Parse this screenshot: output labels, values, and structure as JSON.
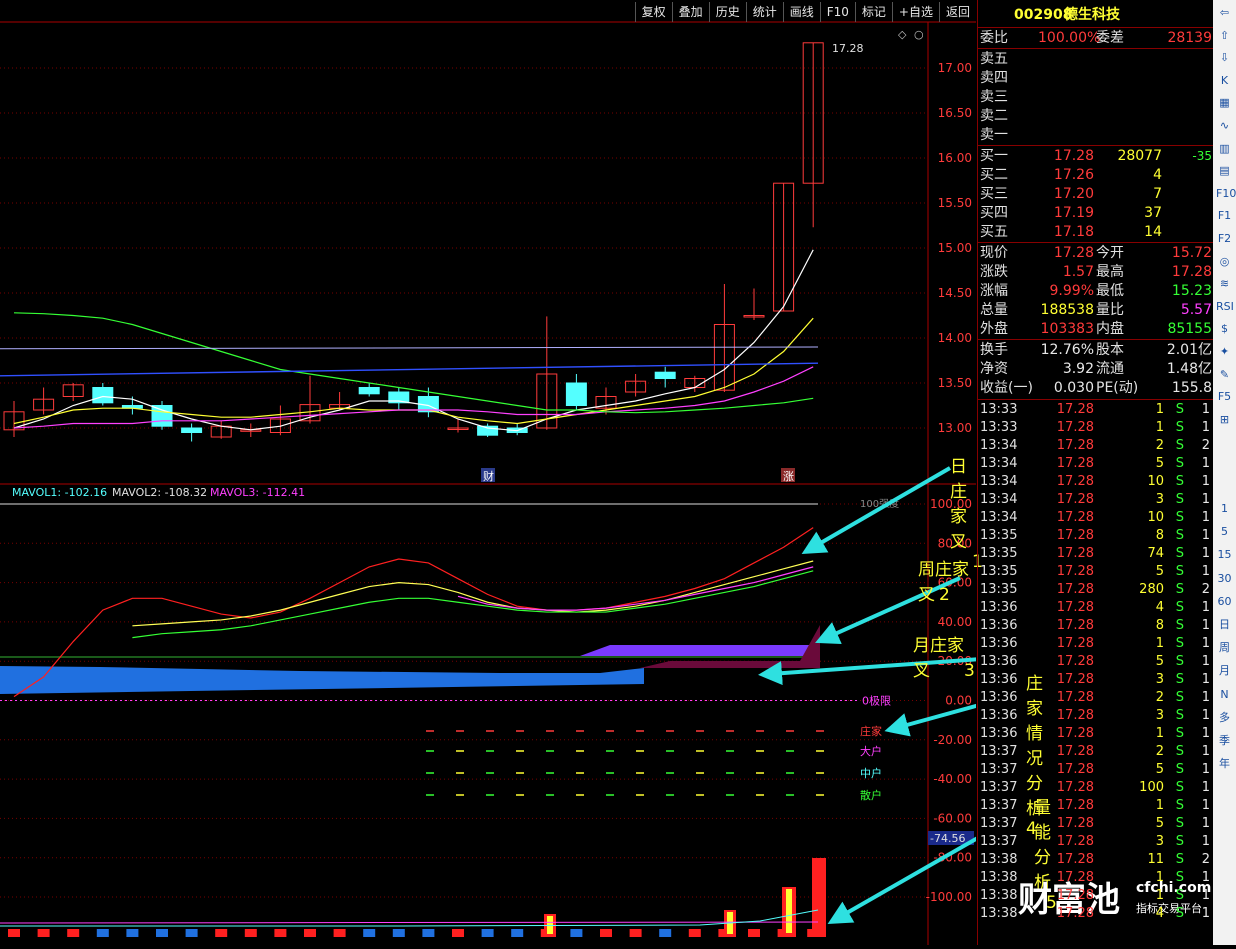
{
  "toolbar": [
    "复权",
    "叠加",
    "历史",
    "统计",
    "画线",
    "F10",
    "标记",
    "+自选",
    "返回"
  ],
  "stock": {
    "code": "002908",
    "name": "德生科技"
  },
  "price_axis": [
    "17.00",
    "16.50",
    "16.00",
    "15.50",
    "15.00",
    "14.50",
    "14.00",
    "13.50",
    "13.00"
  ],
  "last_price_label": "17.28",
  "markers": {
    "cai": "财",
    "zhang": "涨"
  },
  "mavol": {
    "mavol1": "MAVOL1: -102.16",
    "mavol2": "MAVOL2: -108.32",
    "mavol3": "MAVOL3: -112.41"
  },
  "ind_axis": [
    "100.00",
    "80.00",
    "60.00",
    "40.00",
    "20.00",
    "0.00",
    "-20.00",
    "-40.00",
    "-60.00",
    "-80.00",
    "-100.00"
  ],
  "ind_cur_value": "-74.56",
  "ind_100_label": "100强度",
  "ind_legend": {
    "zero": "0极限",
    "zhuangjia": "庄家",
    "dahu": "大户",
    "zhonghu": "中户",
    "sanhu": "散户"
  },
  "annotations": [
    {
      "text": "日庄家叉",
      "num": "1"
    },
    {
      "text": "周庄家叉",
      "num": "2"
    },
    {
      "text": "月庄家叉",
      "num": "3"
    },
    {
      "text": "庄家情况分析",
      "num": "4"
    },
    {
      "text": "量能分析",
      "num": "5"
    }
  ],
  "quote": {
    "weibi_label": "委比",
    "weibi": "100.00%",
    "weicha_label": "委差",
    "weicha": "28139",
    "sell": [
      {
        "label": "卖五"
      },
      {
        "label": "卖四"
      },
      {
        "label": "卖三"
      },
      {
        "label": "卖二"
      },
      {
        "label": "卖一"
      }
    ],
    "buy": [
      {
        "label": "买一",
        "price": "17.28",
        "vol": "28077",
        "chg": "-35"
      },
      {
        "label": "买二",
        "price": "17.26",
        "vol": "4",
        "chg": ""
      },
      {
        "label": "买三",
        "price": "17.20",
        "vol": "7",
        "chg": ""
      },
      {
        "label": "买四",
        "price": "17.19",
        "vol": "37",
        "chg": ""
      },
      {
        "label": "买五",
        "price": "17.18",
        "vol": "14",
        "chg": ""
      }
    ],
    "stats": [
      {
        "l1": "现价",
        "v1": "17.28",
        "c1": "red",
        "l2": "今开",
        "v2": "15.72",
        "c2": "red"
      },
      {
        "l1": "涨跌",
        "v1": "1.57",
        "c1": "red",
        "l2": "最高",
        "v2": "17.28",
        "c2": "red"
      },
      {
        "l1": "涨幅",
        "v1": "9.99%",
        "c1": "red",
        "l2": "最低",
        "v2": "15.23",
        "c2": "green"
      },
      {
        "l1": "总量",
        "v1": "188538",
        "c1": "yellow",
        "l2": "量比",
        "v2": "5.57",
        "c2": "mag"
      },
      {
        "l1": "外盘",
        "v1": "103383",
        "c1": "red",
        "l2": "内盘",
        "v2": "85155",
        "c2": "green"
      }
    ],
    "stats2": [
      {
        "l1": "换手",
        "v1": "12.76%",
        "l2": "股本",
        "v2": "2.01亿"
      },
      {
        "l1": "净资",
        "v1": "3.92",
        "l2": "流通",
        "v2": "1.48亿"
      },
      {
        "l1": "收益(一)",
        "v1": "0.030",
        "l2": "PE(动)",
        "v2": "155.8"
      }
    ]
  },
  "ticks": [
    {
      "t": "13:33",
      "p": "17.28",
      "v": "1",
      "s": "S",
      "n": "1"
    },
    {
      "t": "13:33",
      "p": "17.28",
      "v": "1",
      "s": "S",
      "n": "1"
    },
    {
      "t": "13:34",
      "p": "17.28",
      "v": "2",
      "s": "S",
      "n": "2"
    },
    {
      "t": "13:34",
      "p": "17.28",
      "v": "5",
      "s": "S",
      "n": "1"
    },
    {
      "t": "13:34",
      "p": "17.28",
      "v": "10",
      "s": "S",
      "n": "1"
    },
    {
      "t": "13:34",
      "p": "17.28",
      "v": "3",
      "s": "S",
      "n": "1"
    },
    {
      "t": "13:34",
      "p": "17.28",
      "v": "10",
      "s": "S",
      "n": "1"
    },
    {
      "t": "13:35",
      "p": "17.28",
      "v": "8",
      "s": "S",
      "n": "1"
    },
    {
      "t": "13:35",
      "p": "17.28",
      "v": "74",
      "s": "S",
      "n": "1"
    },
    {
      "t": "13:35",
      "p": "17.28",
      "v": "5",
      "s": "S",
      "n": "1"
    },
    {
      "t": "13:35",
      "p": "17.28",
      "v": "280",
      "s": "S",
      "n": "2"
    },
    {
      "t": "13:36",
      "p": "17.28",
      "v": "4",
      "s": "S",
      "n": "1"
    },
    {
      "t": "13:36",
      "p": "17.28",
      "v": "8",
      "s": "S",
      "n": "1"
    },
    {
      "t": "13:36",
      "p": "17.28",
      "v": "1",
      "s": "S",
      "n": "1"
    },
    {
      "t": "13:36",
      "p": "17.28",
      "v": "5",
      "s": "S",
      "n": "1"
    },
    {
      "t": "13:36",
      "p": "17.28",
      "v": "3",
      "s": "S",
      "n": "1"
    },
    {
      "t": "13:36",
      "p": "17.28",
      "v": "2",
      "s": "S",
      "n": "1"
    },
    {
      "t": "13:36",
      "p": "17.28",
      "v": "3",
      "s": "S",
      "n": "1"
    },
    {
      "t": "13:36",
      "p": "17.28",
      "v": "1",
      "s": "S",
      "n": "1"
    },
    {
      "t": "13:37",
      "p": "17.28",
      "v": "2",
      "s": "S",
      "n": "1"
    },
    {
      "t": "13:37",
      "p": "17.28",
      "v": "5",
      "s": "S",
      "n": "1"
    },
    {
      "t": "13:37",
      "p": "17.28",
      "v": "100",
      "s": "S",
      "n": "1"
    },
    {
      "t": "13:37",
      "p": "17.28",
      "v": "1",
      "s": "S",
      "n": "1"
    },
    {
      "t": "13:37",
      "p": "17.28",
      "v": "5",
      "s": "S",
      "n": "1"
    },
    {
      "t": "13:37",
      "p": "17.28",
      "v": "3",
      "s": "S",
      "n": "1"
    },
    {
      "t": "13:38",
      "p": "17.28",
      "v": "11",
      "s": "S",
      "n": "2"
    },
    {
      "t": "13:38",
      "p": "17.28",
      "v": "1",
      "s": "S",
      "n": "1"
    },
    {
      "t": "13:38",
      "p": "17.28",
      "v": "1",
      "s": "S",
      "n": "1"
    },
    {
      "t": "13:38",
      "p": "17.28",
      "v": "4",
      "s": "S",
      "n": "1"
    }
  ],
  "side_toolbar": [
    "⇦",
    "⇧",
    "⇩",
    "K",
    "▦",
    "∿",
    "▥",
    "▤",
    "F10",
    "F1",
    "F2",
    "◎",
    "≋",
    "RSI",
    "$",
    "✦",
    "✎",
    "F5",
    "⊞",
    "1",
    "5",
    "15",
    "30",
    "60",
    "日",
    "周",
    "月",
    "N",
    "多",
    "季",
    "年"
  ],
  "watermark": {
    "big": "财富池",
    "site": "cfchi.com",
    "sub": "指标交易平台"
  },
  "colors": {
    "up": "#ff3b3b",
    "down": "#54ffff",
    "ma1": "#ffffff",
    "ma2": "#ffff33",
    "ma3": "#ff40ff",
    "ma4": "#35ff35"
  }
}
